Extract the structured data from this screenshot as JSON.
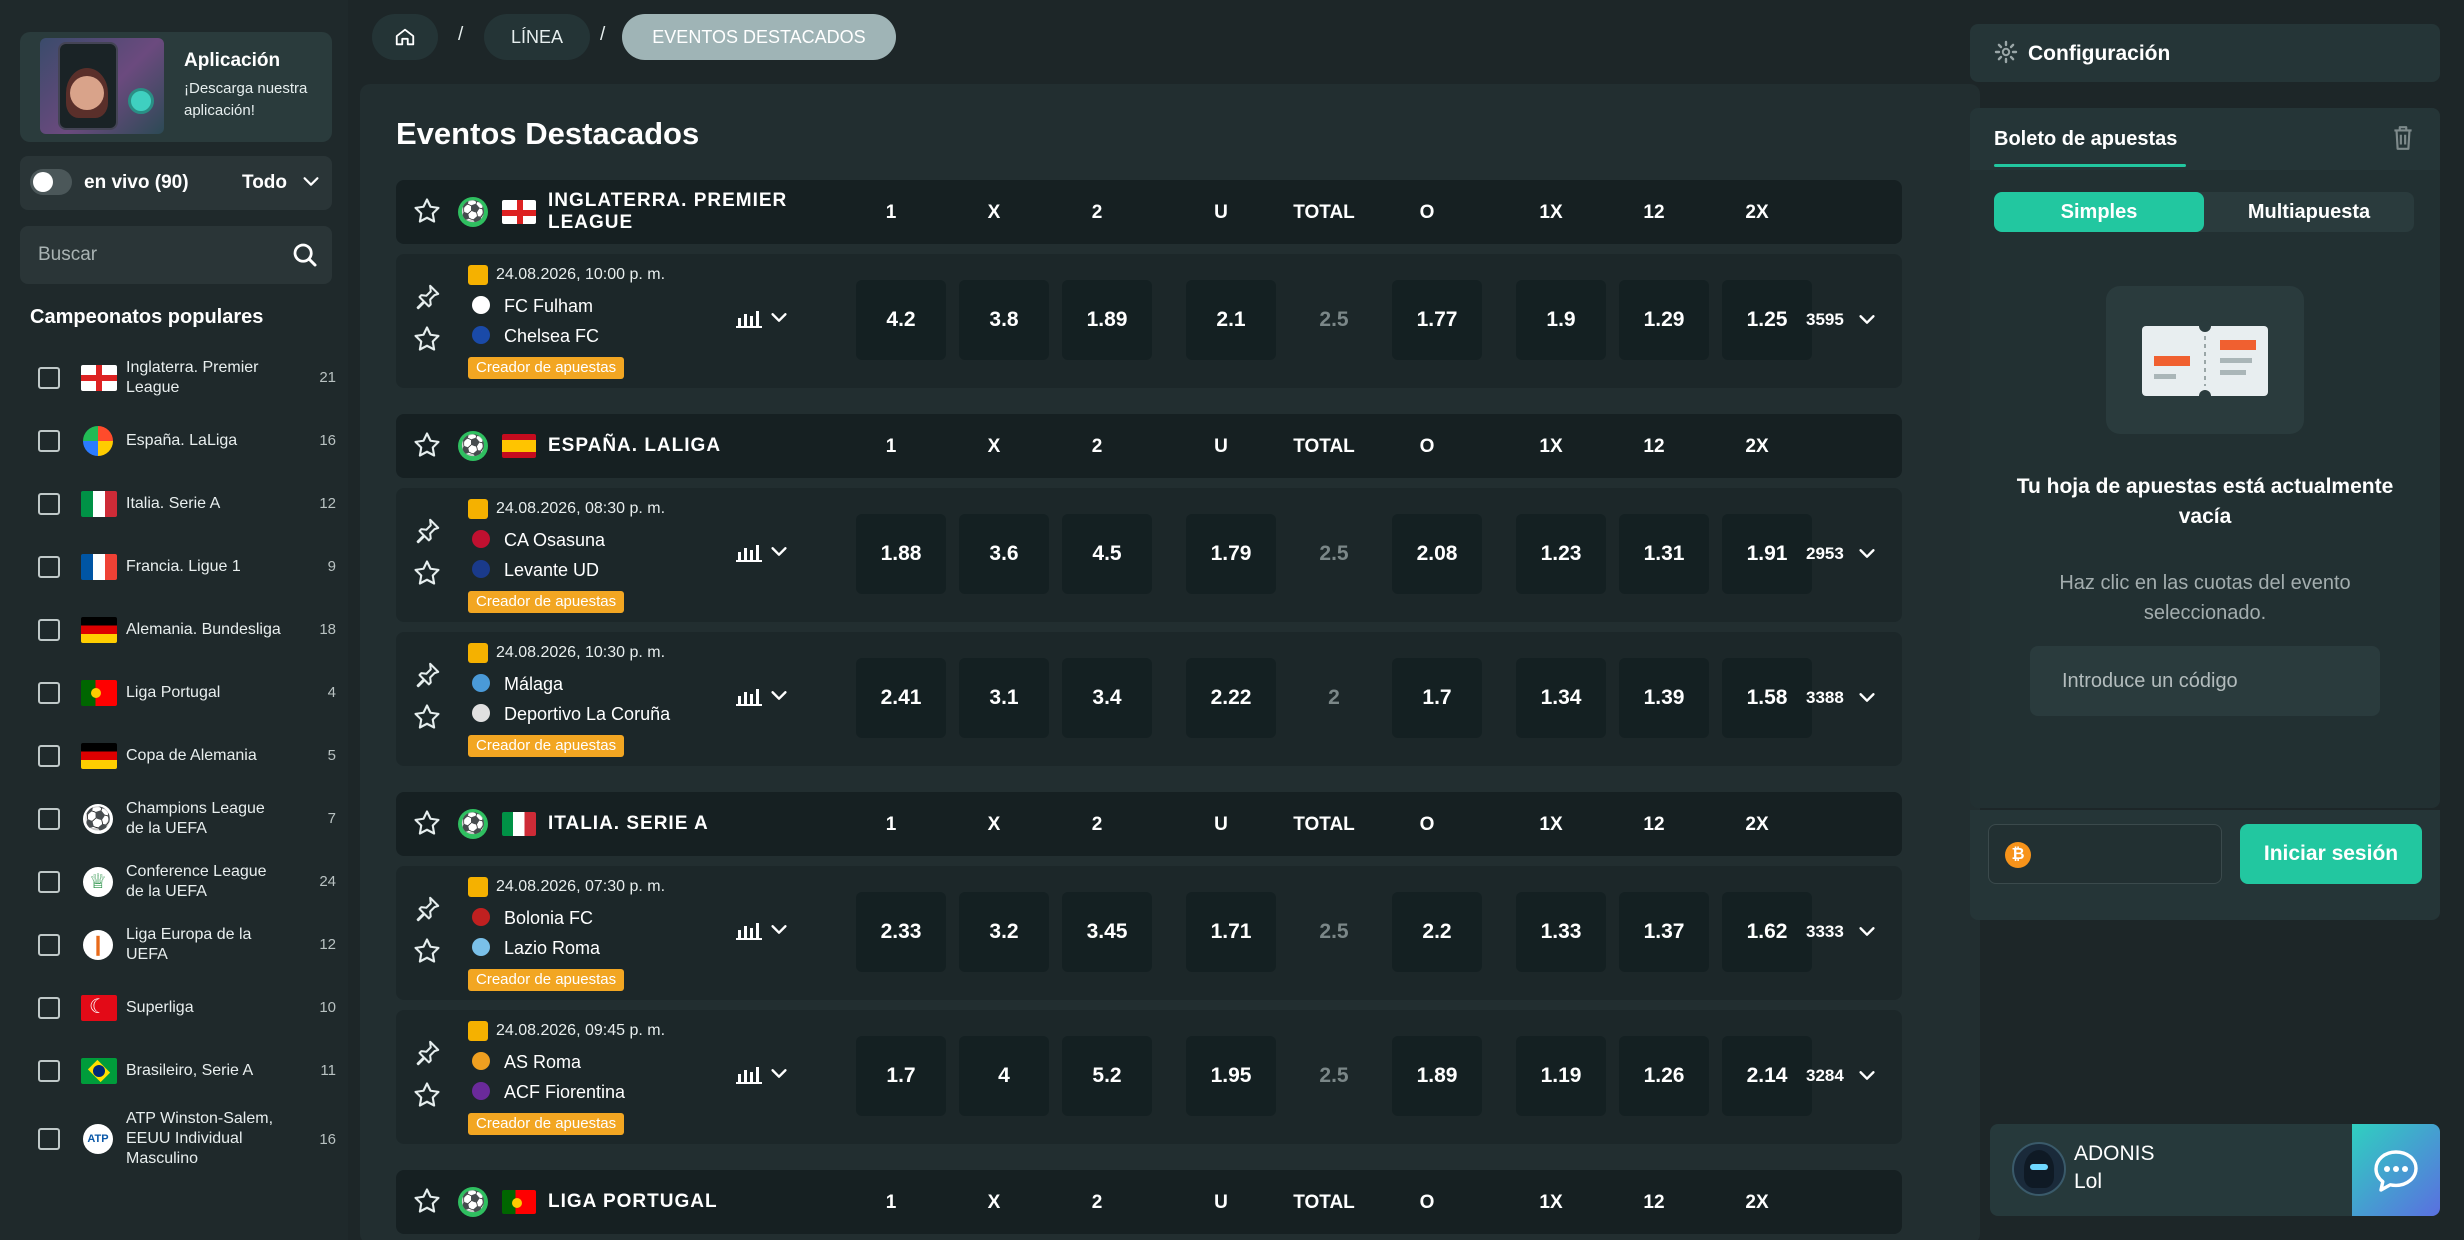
{
  "app_card": {
    "title": "Aplicación",
    "subtitle": "¡Descarga nuestra aplicación!"
  },
  "live": {
    "label": "en vivo (90)",
    "filter": "Todo"
  },
  "search": {
    "placeholder": "Buscar"
  },
  "championships": {
    "title": "Campeonatos populares",
    "items": [
      {
        "name": "Inglaterra. Premier League",
        "count": "21",
        "flag": "england-flag"
      },
      {
        "name": "España. LaLiga",
        "count": "16",
        "flag": "laliga-logo"
      },
      {
        "name": "Italia. Serie A",
        "count": "12",
        "flag": "italy-flag"
      },
      {
        "name": "Francia. Ligue 1",
        "count": "9",
        "flag": "france-flag"
      },
      {
        "name": "Alemania. Bundesliga",
        "count": "18",
        "flag": "germany-flag"
      },
      {
        "name": "Liga Portugal",
        "count": "4",
        "flag": "portugal-flag"
      },
      {
        "name": "Copa de Alemania",
        "count": "5",
        "flag": "germany-flag"
      },
      {
        "name": "Champions League de la UEFA",
        "count": "7",
        "flag": "champions-league-logo"
      },
      {
        "name": "Conference League de la UEFA",
        "count": "24",
        "flag": "conference-league-logo"
      },
      {
        "name": "Liga Europa de la UEFA",
        "count": "12",
        "flag": "europa-league-logo"
      },
      {
        "name": "Superliga",
        "count": "10",
        "flag": "turkey-flag"
      },
      {
        "name": "Brasileiro, Serie A",
        "count": "11",
        "flag": "brazil-flag"
      },
      {
        "name": "ATP Winston-Salem, EEUU Individual Masculino",
        "count": "16",
        "flag": "atp-logo"
      }
    ]
  },
  "breadcrumb": {
    "linea": "LÍNEA",
    "separator": "/",
    "current": "EVENTOS DESTACADOS"
  },
  "main": {
    "title": "Eventos Destacados"
  },
  "headers": [
    "1",
    "X",
    "2",
    "U",
    "TOTAL",
    "O",
    "1X",
    "12",
    "2X"
  ],
  "events_label": "Creador de apuestas",
  "leagues": [
    {
      "name": "INGLATERRA. PREMIER LEAGUE",
      "events": [
        {
          "date": "24.08.2026, 10:00 p. m.",
          "home": "FC Fulham",
          "away": "Chelsea FC",
          "odds": [
            "4.2",
            "3.8",
            "1.89",
            "2.1",
            "2.5",
            "1.77",
            "1.9",
            "1.29",
            "1.25"
          ],
          "more": "3595"
        }
      ]
    },
    {
      "name": "ESPAÑA. LALIGA",
      "events": [
        {
          "date": "24.08.2026, 08:30 p. m.",
          "home": "CA Osasuna",
          "away": "Levante UD",
          "odds": [
            "1.88",
            "3.6",
            "4.5",
            "1.79",
            "2.5",
            "2.08",
            "1.23",
            "1.31",
            "1.91"
          ],
          "more": "2953"
        },
        {
          "date": "24.08.2026, 10:30 p. m.",
          "home": "Málaga",
          "away": "Deportivo La Coruña",
          "odds": [
            "2.41",
            "3.1",
            "3.4",
            "2.22",
            "2",
            "1.7",
            "1.34",
            "1.39",
            "1.58"
          ],
          "more": "3388"
        }
      ]
    },
    {
      "name": "ITALIA. SERIE A",
      "events": [
        {
          "date": "24.08.2026, 07:30 p. m.",
          "home": "Bolonia FC",
          "away": "Lazio Roma",
          "odds": [
            "2.33",
            "3.2",
            "3.45",
            "1.71",
            "2.5",
            "2.2",
            "1.33",
            "1.37",
            "1.62"
          ],
          "more": "3333"
        },
        {
          "date": "24.08.2026, 09:45 p. m.",
          "home": "AS Roma",
          "away": "ACF Fiorentina",
          "odds": [
            "1.7",
            "4",
            "5.2",
            "1.95",
            "2.5",
            "1.89",
            "1.19",
            "1.26",
            "2.14"
          ],
          "more": "3284"
        }
      ]
    },
    {
      "name": "LIGA PORTUGAL",
      "events": []
    }
  ],
  "right": {
    "config": "Configuración",
    "slip_tab": "Boleto de apuestas",
    "seg_simple": "Simples",
    "seg_multi": "Multiapuesta",
    "empty_title": "Tu hoja de apuestas está actualmente vacía",
    "empty_sub": "Haz clic en las cuotas del evento seleccionado.",
    "code_placeholder": "Introduce un código",
    "btc_symbol": "₿",
    "login": "Iniciar sesión"
  },
  "chat": {
    "name": "ADONIS",
    "message": "Lol"
  },
  "colors": {
    "accent": "#22c7a0",
    "creator_badge": "#f2a622",
    "background": "#1d2628"
  }
}
